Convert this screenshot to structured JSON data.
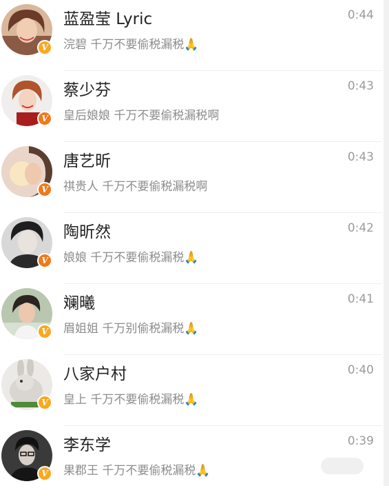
{
  "badge": {
    "glyph": "V",
    "color": "#f7a91f",
    "color_alt": "#ee7a1a"
  },
  "conversations": [
    {
      "avatar_icon": "woman-avatar-icon",
      "name": "蓝盈莹 Lyric",
      "time": "0:44",
      "preview": "浣碧 千万不要偷税漏税🙏"
    },
    {
      "avatar_icon": "woman-avatar-icon",
      "name": "蔡少芬",
      "time": "0:43",
      "preview": "皇后娘娘 千万不要偷税漏税啊"
    },
    {
      "avatar_icon": "woman-avatar-icon",
      "name": "唐艺昕",
      "time": "0:43",
      "preview": "祺贵人 千万不要偷税漏税啊"
    },
    {
      "avatar_icon": "woman-avatar-icon",
      "name": "陶昕然",
      "time": "0:42",
      "preview": "娘娘 千万不要偷税漏税🙏"
    },
    {
      "avatar_icon": "woman-avatar-icon",
      "name": "斓曦",
      "time": "0:41",
      "preview": "眉姐姐 千万别偷税漏税🙏"
    },
    {
      "avatar_icon": "rabbit-avatar-icon",
      "name": "八家户村",
      "time": "0:40",
      "preview": "皇上 千万不要偷税漏税🙏"
    },
    {
      "avatar_icon": "man-avatar-icon",
      "name": "李东学",
      "time": "0:39",
      "preview": "果郡王 千万不要偷税漏税🙏"
    }
  ]
}
